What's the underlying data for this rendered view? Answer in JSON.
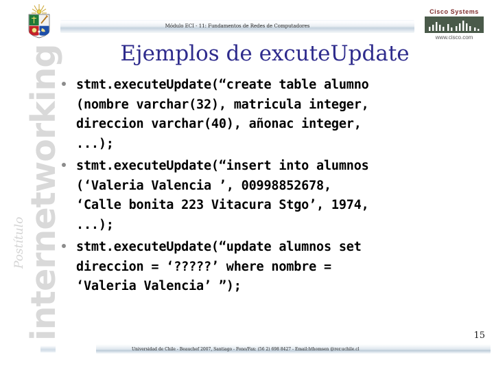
{
  "slide": {
    "header_title": "Módulo ECI - 11: Fundamentos de Redes de Computadores",
    "title": "Ejemplos de excuteUpdate",
    "page_number": "15",
    "footer": "Universidad de Chile - Beauchef 2007, Santiago - Fono/Fax: (56 2) 698 8427 - Email:hthomsen @rer.uchile.cl",
    "title_color": "#2e2b8c",
    "bullet_color": "#8c8c8c",
    "body_text_color": "#000000"
  },
  "sidebar": {
    "brand": "internetworking",
    "program": "Postítulo",
    "brand_color": "#d9d9d9",
    "program_color": "#d4d4d4"
  },
  "logos": {
    "crest_alt": "Universidad de Chile crest",
    "cisco_word": "Cisco Systems",
    "cisco_url": "www.cisco.com",
    "cisco_color": "#7d2b2b"
  },
  "bullets": [
    {
      "text": "stmt.executeUpdate(“create table alumno\n(nombre varchar(32), matricula integer,\ndireccion varchar(40), añonac integer,\n...);"
    },
    {
      "text": "stmt.executeUpdate(“insert into alumnos\n(‘Valeria Valencia ’, 00998852678,\n‘Calle bonita 223 Vitacura Stgo’, 1974,\n...);"
    },
    {
      "text": "stmt.executeUpdate(“update alumnos set\ndireccion = ‘?????’ where nombre =\n‘Valeria Valencia’ ”);"
    }
  ]
}
